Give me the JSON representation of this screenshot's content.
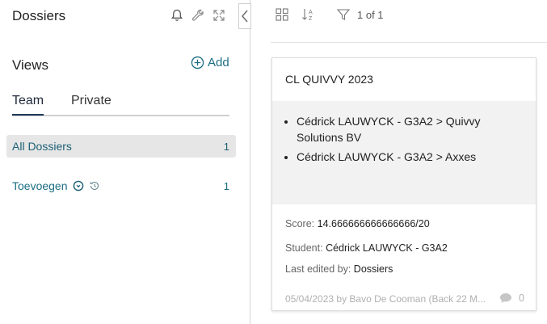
{
  "sidebar": {
    "title": "Dossiers",
    "views_label": "Views",
    "add_label": "Add",
    "tabs": [
      {
        "label": "Team",
        "active": true
      },
      {
        "label": "Private",
        "active": false
      }
    ],
    "views": [
      {
        "label": "All Dossiers",
        "count": "1",
        "active": true
      },
      {
        "label": "Toevoegen",
        "count": "1",
        "active": false
      }
    ]
  },
  "toolbar": {
    "page_count": "1 of 1"
  },
  "card": {
    "title": "CL QUIVVY 2023",
    "items": [
      "Cédrick LAUWYCK - G3A2 > Quivvy Solutions BV",
      "Cédrick LAUWYCK - G3A2 > Axxes"
    ],
    "score_label": "Score:",
    "score_value": "14.666666666666666/20",
    "student_label": "Student:",
    "student_value": "Cédrick LAUWYCK - G3A2",
    "edited_label": "Last edited by:",
    "edited_value": "Dossiers",
    "footer": "05/04/2023 by Bavo De Cooman (Back 22 M...",
    "comment_count": "0"
  },
  "colors": {
    "accent": "#1b6d83",
    "active_row_bg": "#e6e6e6",
    "card_body_bg": "#f2f2f2"
  },
  "icons": [
    "bell-icon",
    "wrench-icon",
    "expand-icon",
    "chevron-left-icon",
    "add-circle-icon",
    "grid-icon",
    "sort-icon",
    "filter-icon",
    "dropdown-circle-icon",
    "history-icon",
    "comment-icon"
  ]
}
